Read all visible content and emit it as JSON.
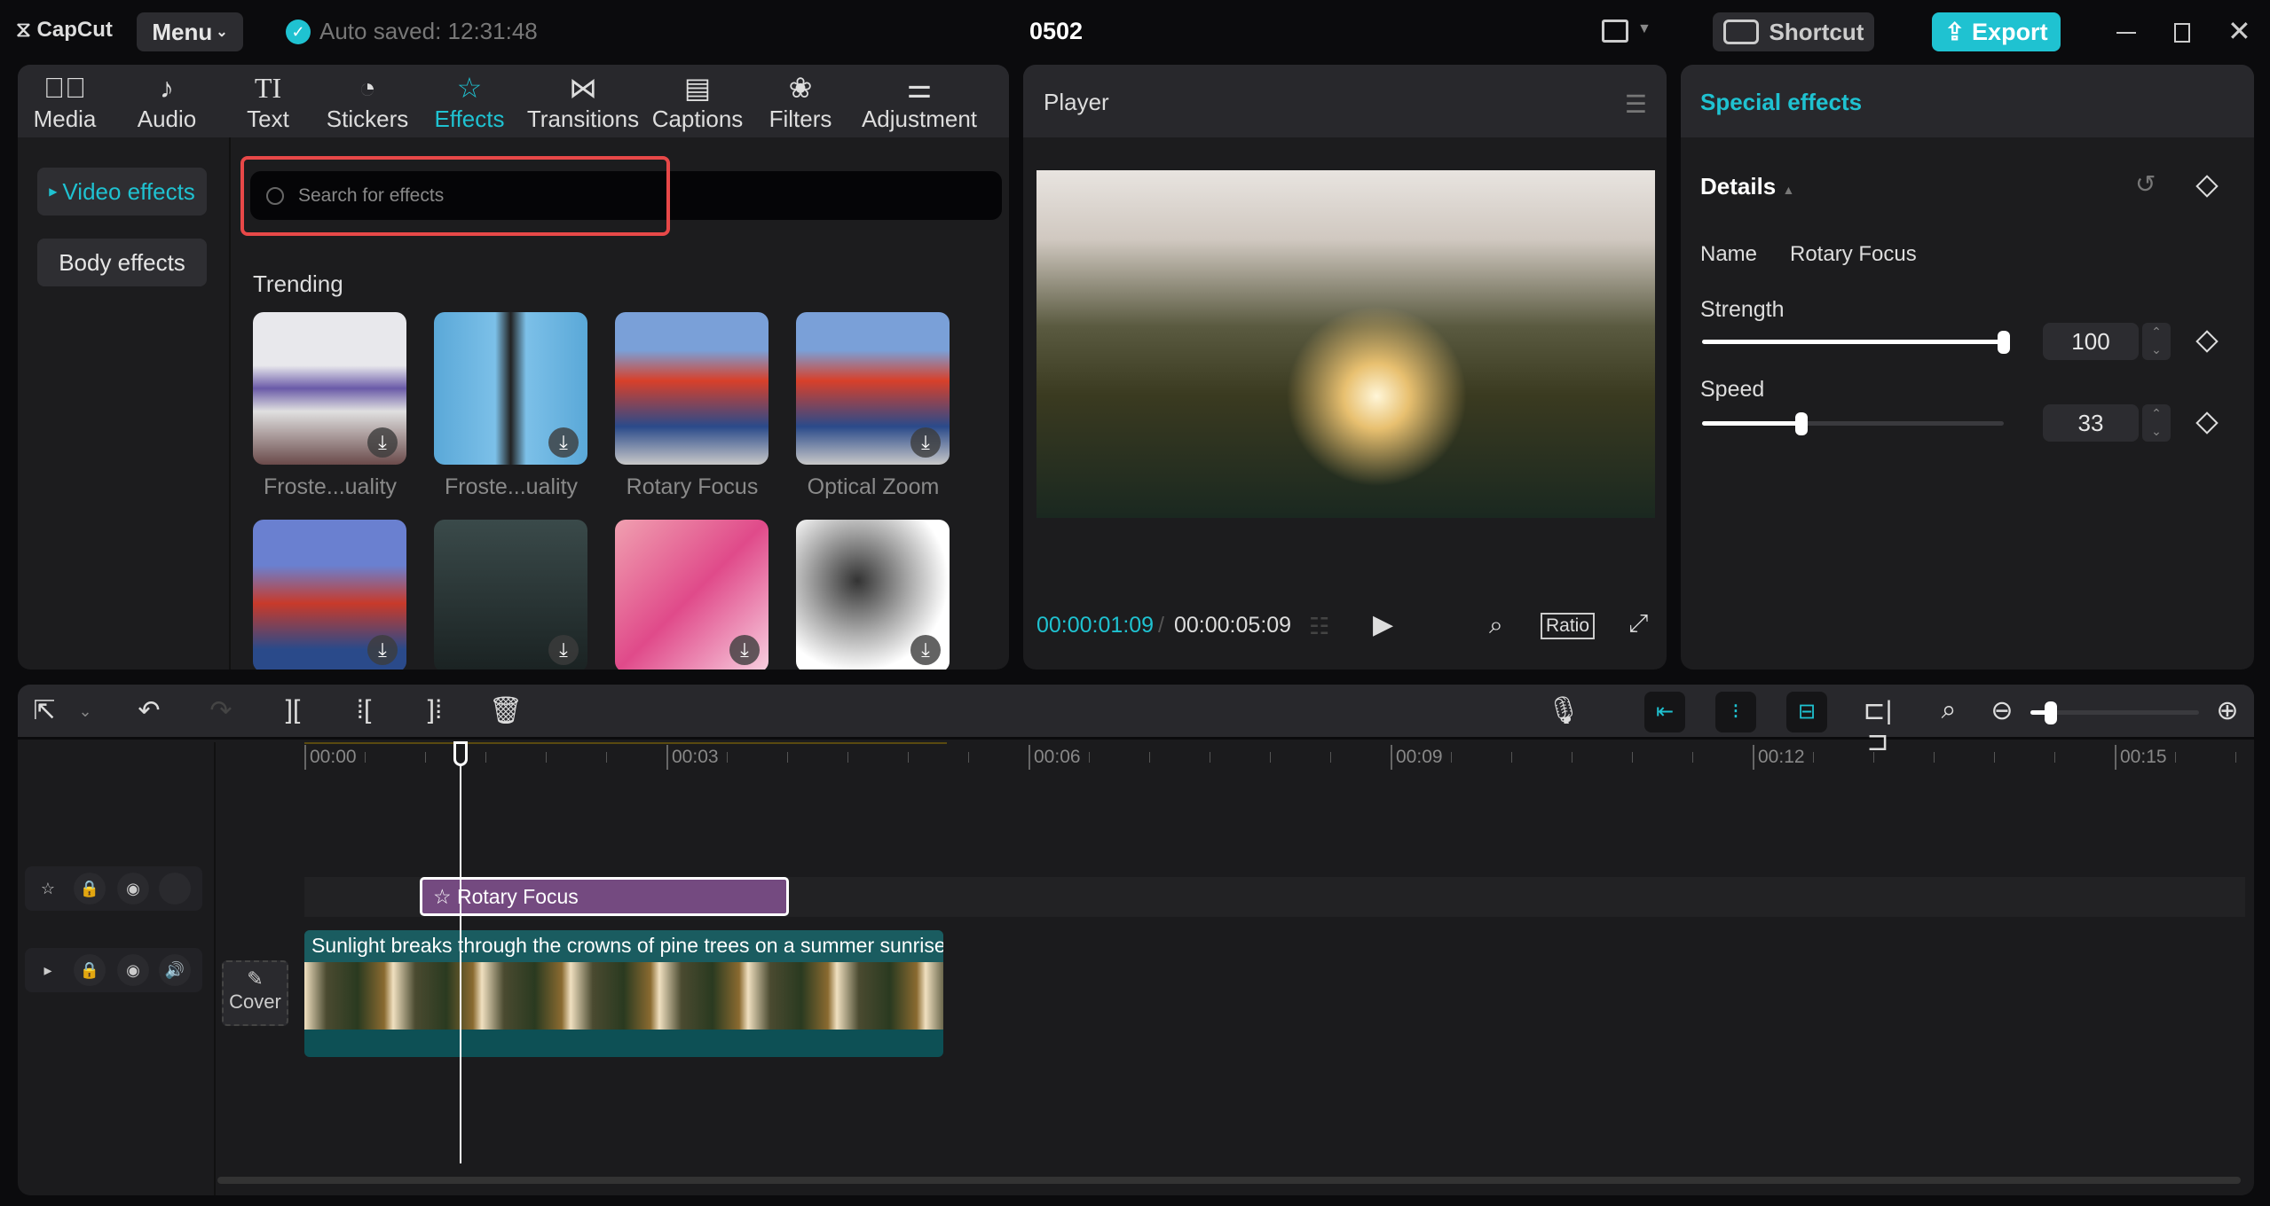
{
  "titlebar": {
    "logo": "CapCut",
    "menu": "Menu",
    "autosave": "Auto saved: 12:31:48",
    "project": "0502",
    "shortcut": "Shortcut",
    "export": "Export"
  },
  "tabs": [
    {
      "label": "Media",
      "icon": "media-icon"
    },
    {
      "label": "Audio",
      "icon": "audio-icon"
    },
    {
      "label": "Text",
      "icon": "text-icon"
    },
    {
      "label": "Stickers",
      "icon": "stickers-icon"
    },
    {
      "label": "Effects",
      "icon": "effects-icon"
    },
    {
      "label": "Transitions",
      "icon": "transitions-icon"
    },
    {
      "label": "Captions",
      "icon": "captions-icon"
    },
    {
      "label": "Filters",
      "icon": "filters-icon"
    },
    {
      "label": "Adjustment",
      "icon": "adjustment-icon"
    }
  ],
  "effects_sidebar": {
    "video_effects": "Video effects",
    "body_effects": "Body effects"
  },
  "search": {
    "placeholder": "Search for effects"
  },
  "trending": {
    "title": "Trending",
    "items": [
      "Froste...uality",
      "Froste...uality",
      "Rotary Focus",
      "Optical Zoom"
    ]
  },
  "player": {
    "title": "Player",
    "current_time": "00:00:01:09",
    "total_time": "00:00:05:09",
    "ratio": "Ratio"
  },
  "inspector": {
    "title": "Special effects",
    "details": "Details",
    "name_label": "Name",
    "name_value": "Rotary Focus",
    "strength_label": "Strength",
    "strength_value": "100",
    "strength_fraction": 1.0,
    "speed_label": "Speed",
    "speed_value": "33",
    "speed_fraction": 0.33
  },
  "timeline": {
    "ruler": [
      "00:00",
      "00:03",
      "00:06",
      "00:09",
      "00:12",
      "00:15"
    ],
    "effect_clip": "Rotary Focus",
    "video_clip": "Sunlight breaks through the crowns of pine trees on a summer sunrise",
    "cover": "Cover",
    "zoom_fraction": 0.12
  },
  "colors": {
    "accent": "#1fc2d1",
    "effect_clip": "#744a80",
    "video_clip": "#1a5c60",
    "highlight": "#e84848"
  }
}
